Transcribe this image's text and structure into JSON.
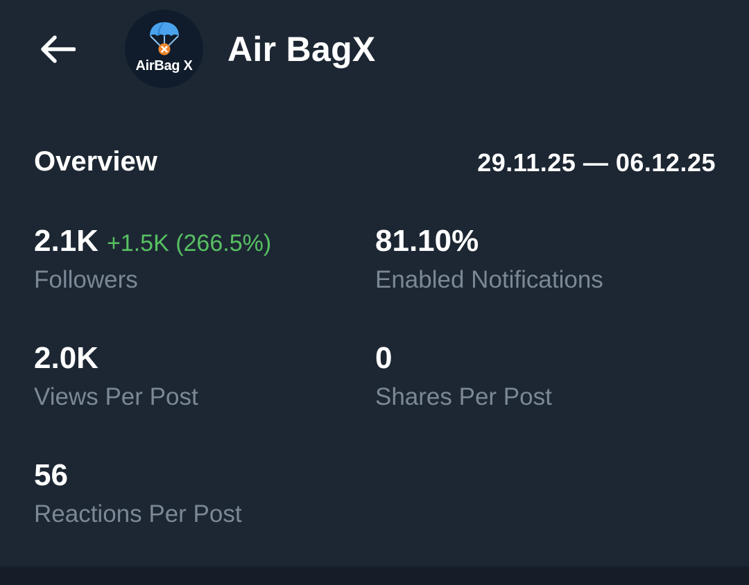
{
  "header": {
    "back_icon": "arrow-left-icon",
    "avatar_logo_icon": "parachute-icon",
    "avatar_logo_text": "AirBag X",
    "title": "Air BagX"
  },
  "overview": {
    "title": "Overview",
    "date_range": "29.11.25 — 06.12.25",
    "stats": {
      "followers": {
        "value": "2.1K",
        "delta": "+1.5K (266.5%)",
        "label": "Followers"
      },
      "enabled_notifications": {
        "value": "81.10%",
        "label": "Enabled Notifications"
      },
      "views_per_post": {
        "value": "2.0K",
        "label": "Views Per Post"
      },
      "shares_per_post": {
        "value": "0",
        "label": "Shares Per Post"
      },
      "reactions_per_post": {
        "value": "56",
        "label": "Reactions Per Post"
      }
    }
  },
  "colors": {
    "background": "#1d2733",
    "text_primary": "#ffffff",
    "text_secondary": "#7d8896",
    "positive": "#57c062",
    "logo_blue": "#4aa3ec",
    "logo_orange": "#f0862b"
  }
}
